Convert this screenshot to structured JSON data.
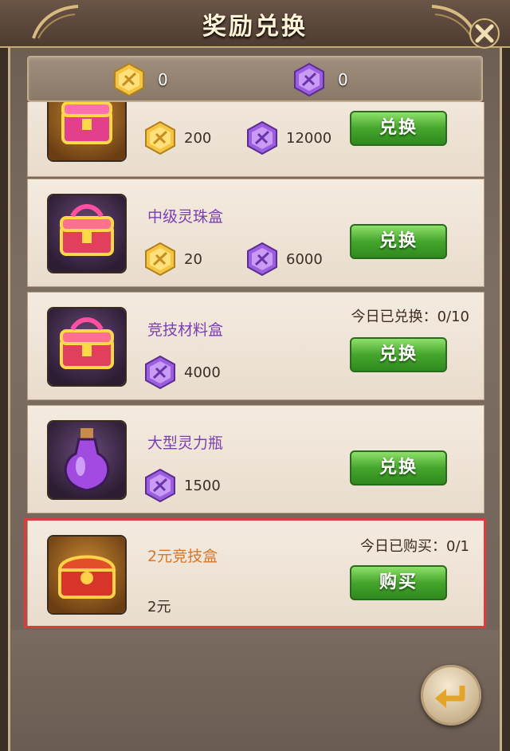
{
  "window": {
    "title": "奖励兑换"
  },
  "currencies": [
    {
      "icon": "gold-token-icon",
      "value": "0"
    },
    {
      "icon": "purple-token-icon",
      "value": "0"
    }
  ],
  "items": [
    {
      "name": "",
      "name_color": "orange",
      "thumb": "treasure-chest-icon",
      "costs": [
        {
          "icon": "gold-token-icon",
          "value": "200"
        },
        {
          "icon": "purple-token-icon",
          "value": "12000"
        }
      ],
      "limit": "",
      "button": "兑换"
    },
    {
      "name": "中级灵珠盒",
      "thumb": "treasure-chest-icon",
      "costs": [
        {
          "icon": "gold-token-icon",
          "value": "20"
        },
        {
          "icon": "purple-token-icon",
          "value": "6000"
        }
      ],
      "limit": "",
      "button": "兑换"
    },
    {
      "name": "竞技材料盒",
      "thumb": "treasure-chest-icon",
      "costs": [
        {
          "icon": "purple-token-icon",
          "value": "4000"
        }
      ],
      "limit": "今日已兑换：0/10",
      "button": "兑换"
    },
    {
      "name": "大型灵力瓶",
      "thumb": "potion-bottle-icon",
      "costs": [
        {
          "icon": "purple-token-icon",
          "value": "1500"
        }
      ],
      "limit": "",
      "button": "兑换"
    },
    {
      "name": "2元竞技盒",
      "thumb": "gold-chest-icon",
      "price": "2元",
      "limit": "今日已购买：0/1",
      "button": "购买"
    }
  ],
  "colors": {
    "highlight_border": "#e03a3a",
    "button_green": "#45a52c",
    "name_purple": "#7a3fb2",
    "name_orange": "#d6772a"
  }
}
